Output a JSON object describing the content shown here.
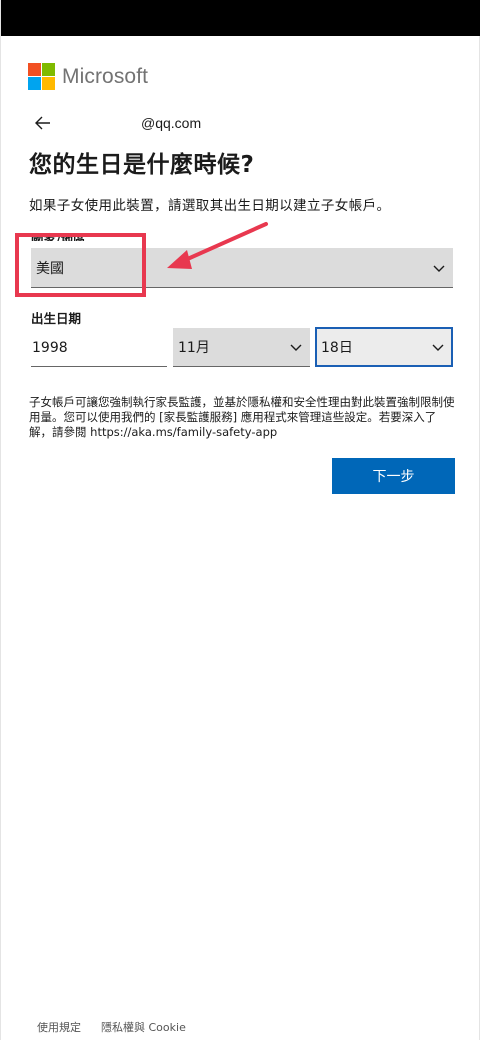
{
  "brand": {
    "name": "Microsoft",
    "colors": [
      "#f25022",
      "#7fba00",
      "#00a4ef",
      "#ffb900"
    ]
  },
  "header": {
    "back_icon": "arrow-left-icon",
    "email": "@qq.com"
  },
  "page": {
    "title": "您的生日是什麼時候?",
    "description": "如果子女使用此裝置，請選取其出生日期以建立子女帳戶。"
  },
  "form": {
    "country_label": "國家/地區",
    "country_value": "美國",
    "birthdate_label": "出生日期",
    "year_value": "1998",
    "month_value": "11月",
    "day_value": "18日"
  },
  "info_text": "子女帳戶可讓您強制執行家長監護，並基於隱私權和安全性理由對此裝置強制限制使用量。您可以使用我們的 [家長監護服務] 應用程式來管理這些設定。若要深入了解，請參閱 https://aka.ms/family-safety-app",
  "actions": {
    "next_label": "下一步"
  },
  "footer": {
    "terms": "使用規定",
    "privacy": "隱私權與 Cookie"
  },
  "annotation": {
    "color": "#e8384f"
  }
}
